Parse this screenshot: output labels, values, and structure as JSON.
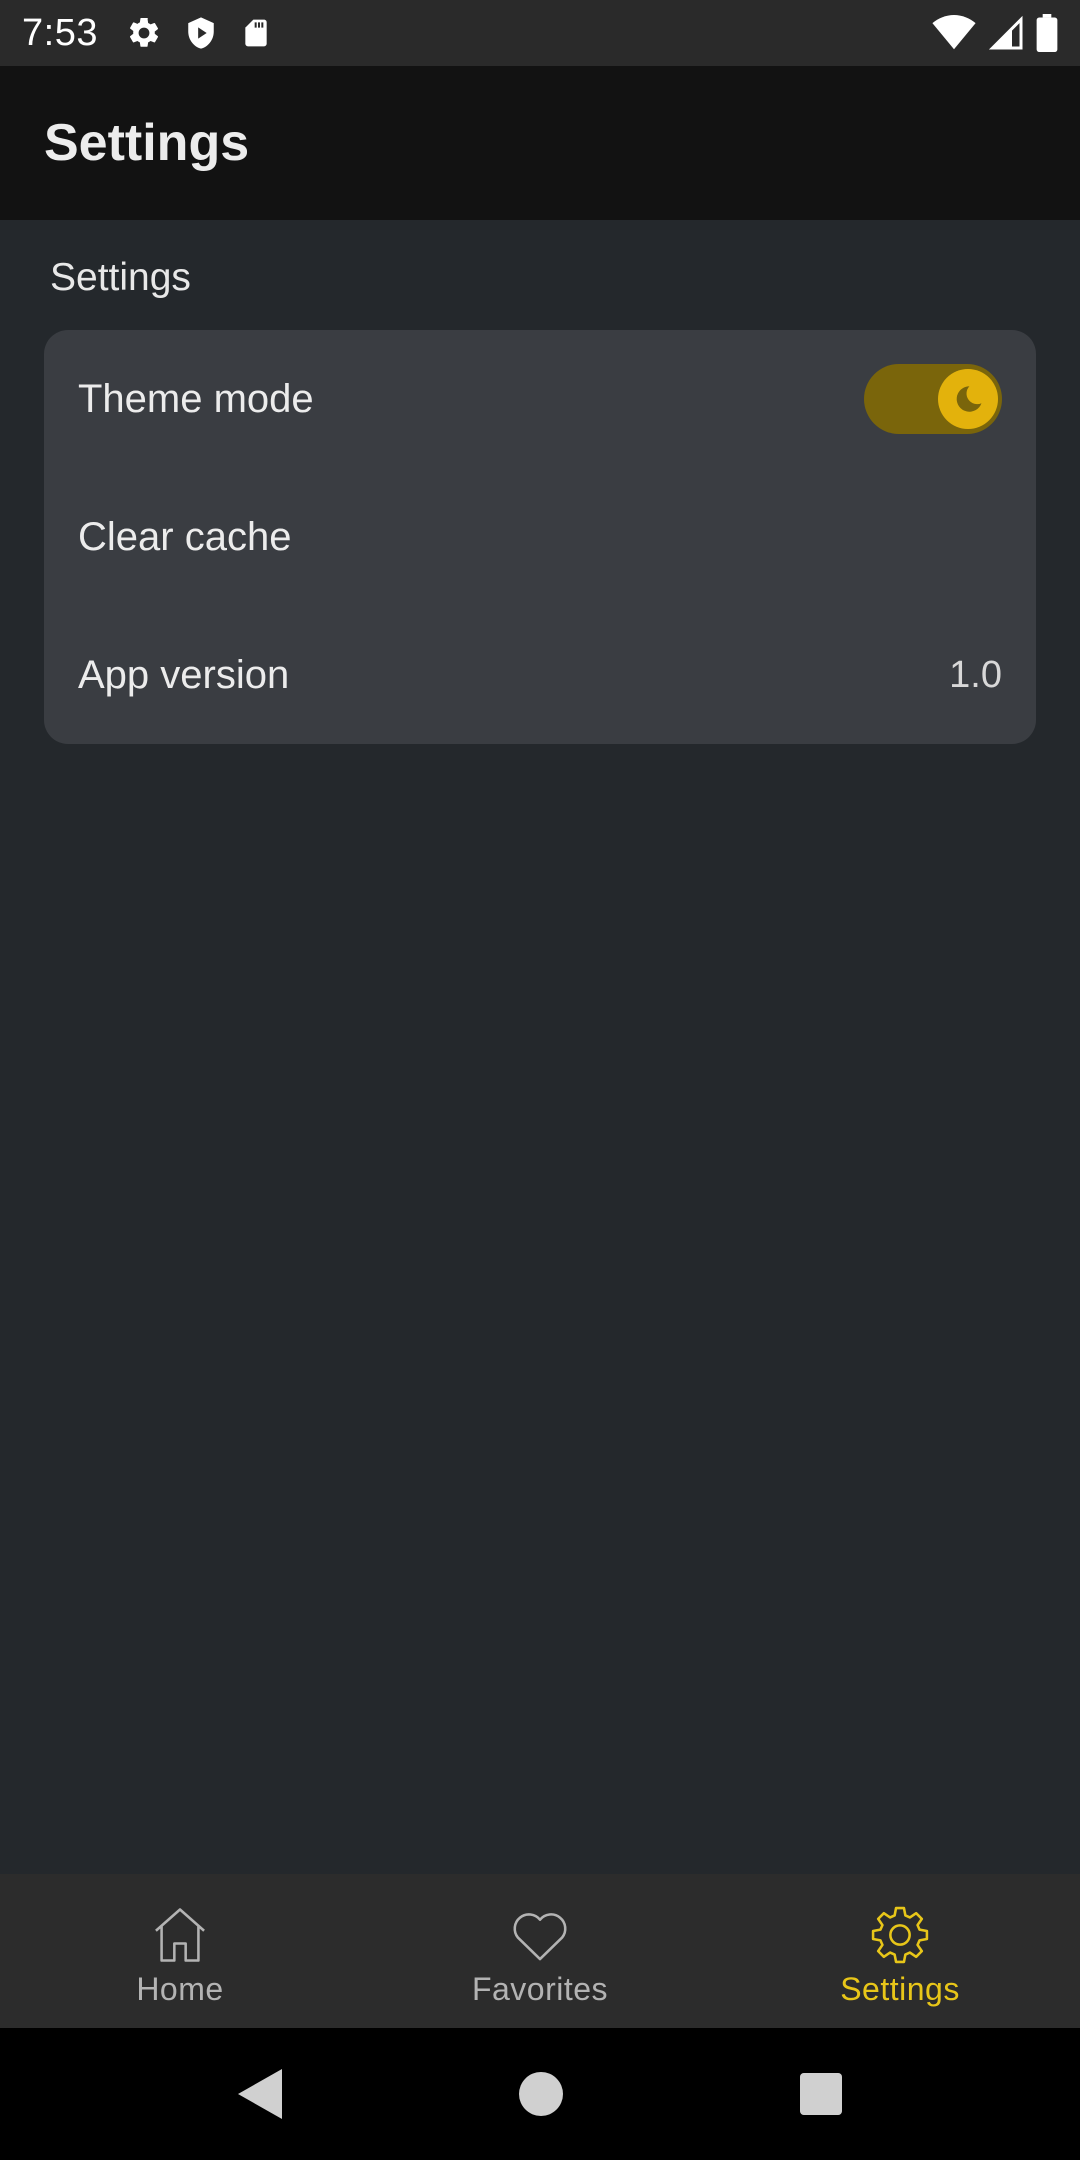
{
  "status_bar": {
    "time": "7:53",
    "left_icons": [
      "gear-icon",
      "shield-icon",
      "sd-card-icon"
    ],
    "right_icons": [
      "wifi-icon",
      "cell-signal-icon",
      "battery-icon"
    ]
  },
  "app_bar": {
    "title": "Settings"
  },
  "content": {
    "section_title": "Settings",
    "rows": [
      {
        "label": "Theme mode",
        "control": "toggle",
        "toggle_on": true,
        "icon": "moon-icon"
      },
      {
        "label": "Clear cache"
      },
      {
        "label": "App version",
        "value": "1.0"
      }
    ]
  },
  "bottom_nav": {
    "items": [
      {
        "label": "Home",
        "icon": "home-icon",
        "active": false
      },
      {
        "label": "Favorites",
        "icon": "heart-icon",
        "active": false
      },
      {
        "label": "Settings",
        "icon": "gear-icon",
        "active": true
      }
    ]
  },
  "system_nav": {
    "buttons": [
      "back-icon",
      "home-circle-icon",
      "recents-icon"
    ]
  },
  "colors": {
    "accent": "#e8c619",
    "toggle_track": "#7a650b",
    "toggle_knob": "#e3b20c",
    "background": "#24282c",
    "card": "#3a3d42",
    "app_bar": "#121212"
  }
}
